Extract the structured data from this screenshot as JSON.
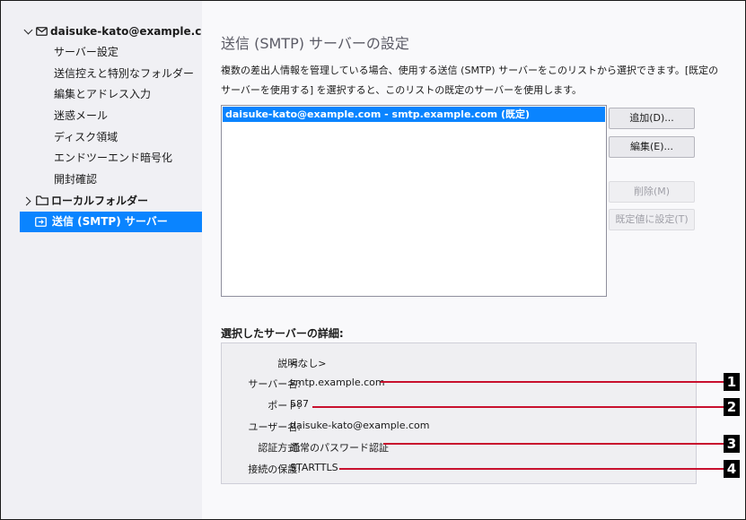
{
  "sidebar": {
    "account": "daisuke-kato@example.com",
    "items": [
      {
        "label": "サーバー設定"
      },
      {
        "label": "送信控えと特別なフォルダー"
      },
      {
        "label": "編集とアドレス入力"
      },
      {
        "label": "迷惑メール"
      },
      {
        "label": "ディスク領域"
      },
      {
        "label": "エンドツーエンド暗号化"
      },
      {
        "label": "開封確認"
      }
    ],
    "local_folders": "ローカルフォルダー",
    "smtp": "送信 (SMTP) サーバー"
  },
  "main": {
    "title": "送信 (SMTP) サーバーの設定",
    "description": "複数の差出人情報を管理している場合、使用する送信 (SMTP) サーバーをこのリストから選択できます。[既定のサーバーを使用する] を選択すると、このリストの既定のサーバーを使用します。",
    "servers": [
      "daisuke-kato@example.com - smtp.example.com (既定)"
    ],
    "buttons": {
      "add": "追加(D)...",
      "edit": "編集(E)...",
      "delete": "削除(M)",
      "set_default": "既定値に設定(T)"
    },
    "details_heading": "選択したサーバーの詳細:",
    "details": {
      "description_label": "説明:",
      "description_value": "<なし>",
      "server_label": "サーバー名:",
      "server_value": "smtp.example.com",
      "port_label": "ポート:",
      "port_value": "587",
      "user_label": "ユーザー名:",
      "user_value": "daisuke-kato@example.com",
      "auth_label": "認証方式:",
      "auth_value": "通常のパスワード認証",
      "security_label": "接続の保護:",
      "security_value": "STARTTLS"
    }
  },
  "callouts": [
    "1",
    "2",
    "3",
    "4"
  ],
  "colors": {
    "accent": "#0a84ff",
    "callout_line": "#c8102e"
  }
}
